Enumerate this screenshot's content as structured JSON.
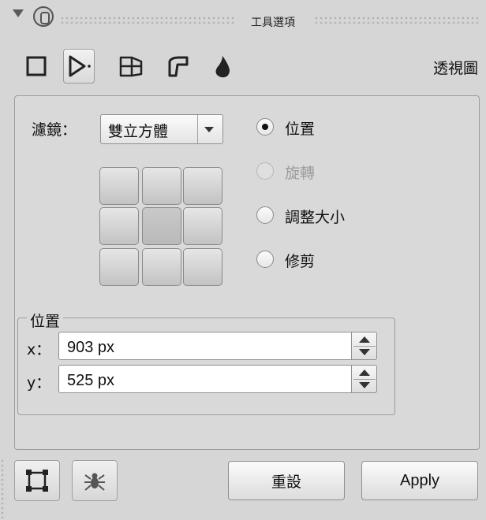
{
  "title_bar": {
    "title": "工具選項"
  },
  "toolbar": {
    "tools": [
      {
        "icon": "unified-transform-icon"
      },
      {
        "icon": "perspective-transform-icon",
        "active": true
      },
      {
        "icon": "3d-transform-icon"
      },
      {
        "icon": "warp-transform-icon"
      },
      {
        "icon": "liquify-drop-icon"
      }
    ],
    "mode_label": "透視圖"
  },
  "filter": {
    "label": "濾鏡：",
    "selected": "雙立方體"
  },
  "radio_options": [
    {
      "label": "位置",
      "checked": true,
      "enabled": true
    },
    {
      "label": "旋轉",
      "checked": false,
      "enabled": false
    },
    {
      "label": "調整大小",
      "checked": false,
      "enabled": true
    },
    {
      "label": "修剪",
      "checked": false,
      "enabled": true
    }
  ],
  "position_group": {
    "title": "位置",
    "x_label": "x：",
    "x_value": "903 px",
    "y_label": "y：",
    "y_value": "525 px"
  },
  "footer": {
    "reset_label": "重設",
    "apply_label": "Apply"
  },
  "colors": {
    "background": "#d6d6d6",
    "border": "#9c9c9c"
  }
}
